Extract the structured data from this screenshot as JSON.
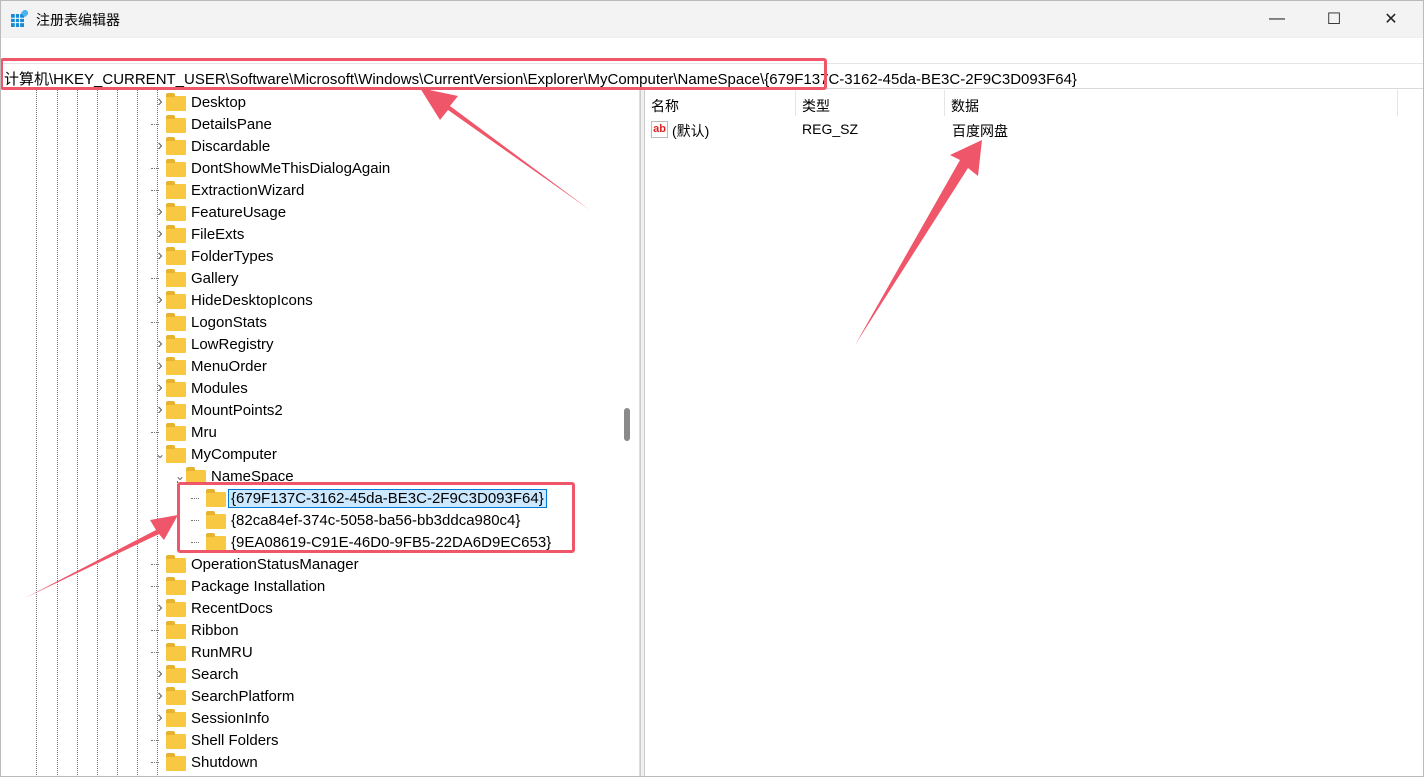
{
  "window": {
    "title": "注册表编辑器",
    "minimize": "—",
    "maximize": "☐",
    "close": "✕"
  },
  "address": {
    "path": "计算机\\HKEY_CURRENT_USER\\Software\\Microsoft\\Windows\\CurrentVersion\\Explorer\\MyComputer\\NameSpace\\{679F137C-3162-45da-BE3C-2F9C3D093F64}"
  },
  "tree": {
    "items": [
      {
        "label": "Desktop",
        "chevron": true
      },
      {
        "label": "DetailsPane",
        "chevron": false
      },
      {
        "label": "Discardable",
        "chevron": true
      },
      {
        "label": "DontShowMeThisDialogAgain",
        "chevron": false
      },
      {
        "label": "ExtractionWizard",
        "chevron": false
      },
      {
        "label": "FeatureUsage",
        "chevron": true
      },
      {
        "label": "FileExts",
        "chevron": true
      },
      {
        "label": "FolderTypes",
        "chevron": true
      },
      {
        "label": "Gallery",
        "chevron": false
      },
      {
        "label": "HideDesktopIcons",
        "chevron": true
      },
      {
        "label": "LogonStats",
        "chevron": false
      },
      {
        "label": "LowRegistry",
        "chevron": true
      },
      {
        "label": "MenuOrder",
        "chevron": true
      },
      {
        "label": "Modules",
        "chevron": true
      },
      {
        "label": "MountPoints2",
        "chevron": true
      },
      {
        "label": "Mru",
        "chevron": false
      },
      {
        "label": "MyComputer",
        "chevron": "open"
      }
    ],
    "namespace": "NameSpace",
    "children": [
      "{679F137C-3162-45da-BE3C-2F9C3D093F64}",
      "{82ca84ef-374c-5058-ba56-bb3ddca980c4}",
      "{9EA08619-C91E-46D0-9FB5-22DA6D9EC653}"
    ],
    "after": [
      {
        "label": "OperationStatusManager",
        "chevron": false
      },
      {
        "label": "Package Installation",
        "chevron": false
      },
      {
        "label": "RecentDocs",
        "chevron": true
      },
      {
        "label": "Ribbon",
        "chevron": false
      },
      {
        "label": "RunMRU",
        "chevron": false
      },
      {
        "label": "Search",
        "chevron": true
      },
      {
        "label": "SearchPlatform",
        "chevron": true
      },
      {
        "label": "SessionInfo",
        "chevron": true
      },
      {
        "label": "Shell Folders",
        "chevron": false
      },
      {
        "label": "Shutdown",
        "chevron": false
      }
    ]
  },
  "list": {
    "headers": [
      "名称",
      "类型",
      "数据"
    ],
    "rows": [
      {
        "name": "(默认)",
        "type": "REG_SZ",
        "data": "百度网盘",
        "icon": "ab"
      }
    ]
  },
  "colors": {
    "annotation": "#f0566a",
    "selection": "#cce8ff",
    "folder": "#f8c843"
  }
}
